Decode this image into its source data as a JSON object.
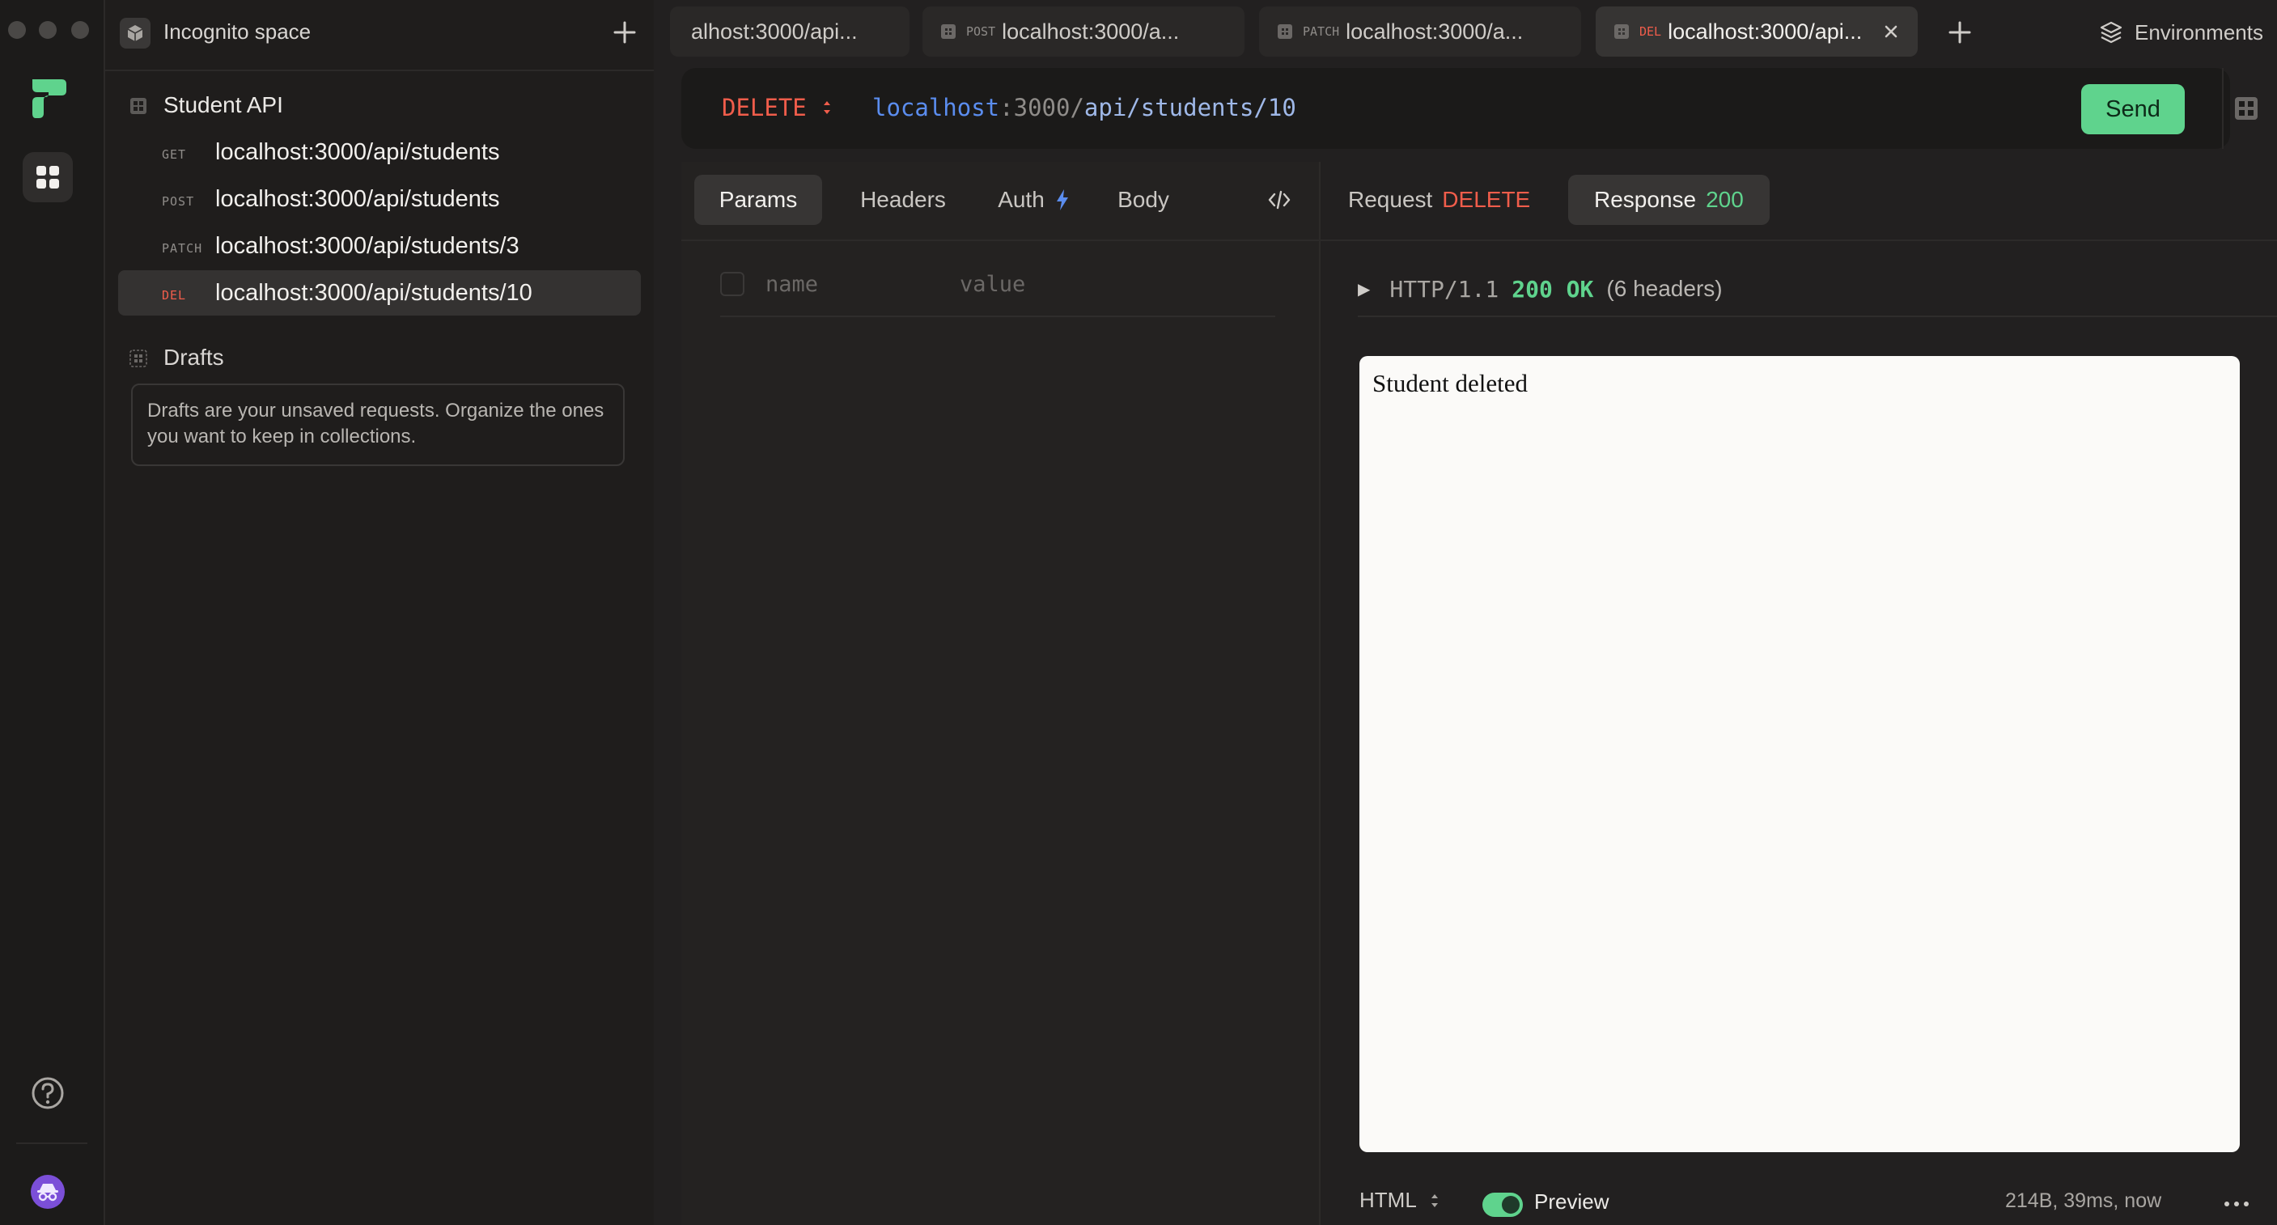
{
  "space": {
    "name": "Incognito space"
  },
  "sidebar": {
    "collection": {
      "name": "Student API",
      "requests": [
        {
          "method": "GET",
          "url": "localhost:3000/api/students",
          "active": false
        },
        {
          "method": "POST",
          "url": "localhost:3000/api/students",
          "active": false
        },
        {
          "method": "PATCH",
          "url": "localhost:3000/api/students/3",
          "active": false
        },
        {
          "method": "DEL",
          "url": "localhost:3000/api/students/10",
          "active": true
        }
      ]
    },
    "drafts": {
      "title": "Drafts",
      "description": "Drafts are your unsaved requests. Organize the ones you want to keep in collections."
    }
  },
  "tabs": [
    {
      "method": "",
      "label": "alhost:3000/api...",
      "active": false
    },
    {
      "method": "POST",
      "label": "localhost:3000/a...",
      "active": false
    },
    {
      "method": "PATCH",
      "label": "localhost:3000/a...",
      "active": false
    },
    {
      "method": "DEL",
      "label": "localhost:3000/api...",
      "active": true
    }
  ],
  "environments_label": "Environments",
  "request": {
    "method": "DELETE",
    "url_parts": {
      "host": "localhost",
      "sep": ":",
      "port": "3000/",
      "path": "api/students/10"
    },
    "send_label": "Send",
    "tabs": [
      "Params",
      "Headers",
      "Auth",
      "Body"
    ],
    "params_placeholder": {
      "name": "name",
      "value": "value"
    }
  },
  "response": {
    "request_tab": {
      "label": "Request",
      "method": "DELETE"
    },
    "response_tab": {
      "label": "Response",
      "status": "200"
    },
    "status_line": {
      "protocol": "HTTP/1.1",
      "status": "200 OK",
      "headers": "(6 headers)"
    },
    "body_preview": "Student deleted",
    "format": "HTML",
    "preview_label": "Preview",
    "preview_on": true,
    "meta": "214B, 39ms, now"
  },
  "colors": {
    "accent_green": "#5fd38d",
    "method_delete": "#f05d4b",
    "url_host": "#5b8def",
    "url_port": "#8f8c89",
    "url_path": "#9fb8e8"
  }
}
